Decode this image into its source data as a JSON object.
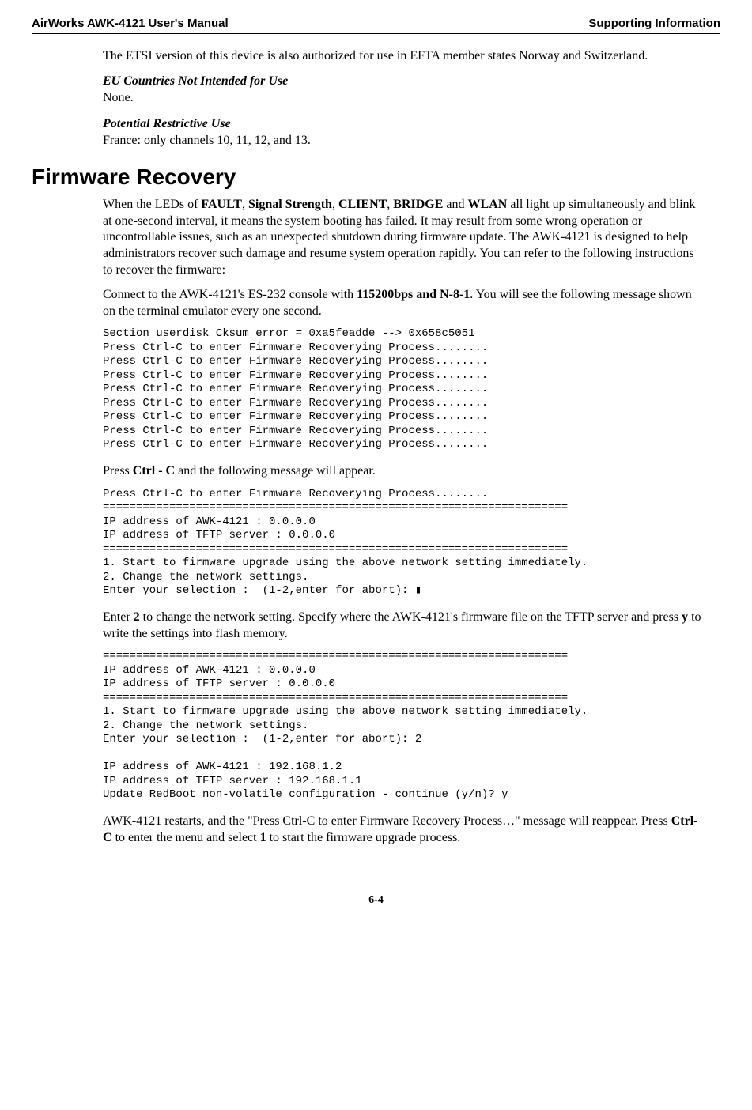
{
  "header": {
    "left": "AirWorks AWK-4121 User's Manual",
    "right": "Supporting Information"
  },
  "intro": {
    "etsi_para": "The ETSI version of this device is also authorized for use in EFTA member states Norway and Switzerland.",
    "eu_head": "EU Countries Not Intended for Use",
    "eu_body": "None.",
    "pr_head": "Potential Restrictive Use",
    "pr_body": "France: only channels 10, 11, 12, and 13."
  },
  "recovery": {
    "title": "Firmware Recovery",
    "p1_pre": "When the LEDs of ",
    "b1": "FAULT",
    "sep": ", ",
    "b2": "Signal Strength",
    "b3": "CLIENT",
    "b4": "BRIDGE",
    "and": " and ",
    "b5": "WLAN",
    "p1_post": " all light up simultaneously and blink at one-second interval, it means the system booting has failed. It may result from some wrong operation or uncontrollable issues, such as an unexpected shutdown during firmware update. The AWK-4121 is designed to help administrators recover such damage and resume system operation rapidly. You can refer to the following instructions to recover the firmware:",
    "p2_pre": "Connect to the AWK-4121's ES-232 console with ",
    "p2_bold": "115200bps and N-8-1",
    "p2_post": ". You will see the following message shown on the terminal emulator every one second.",
    "term1": "Section userdisk Cksum error = 0xa5feadde --> 0x658c5051\nPress Ctrl-C to enter Firmware Recoverying Process........\nPress Ctrl-C to enter Firmware Recoverying Process........\nPress Ctrl-C to enter Firmware Recoverying Process........\nPress Ctrl-C to enter Firmware Recoverying Process........\nPress Ctrl-C to enter Firmware Recoverying Process........\nPress Ctrl-C to enter Firmware Recoverying Process........\nPress Ctrl-C to enter Firmware Recoverying Process........\nPress Ctrl-C to enter Firmware Recoverying Process........",
    "p3_pre": "Press ",
    "p3_bold": "Ctrl - C",
    "p3_post": " and the following message will appear.",
    "term2": "Press Ctrl-C to enter Firmware Recoverying Process........\n======================================================================\nIP address of AWK-4121 : 0.0.0.0\nIP address of TFTP server : 0.0.0.0\n======================================================================\n1. Start to firmware upgrade using the above network setting immediately.\n2. Change the network settings.\nEnter your selection :  (1-2,enter for abort): ▮",
    "p4_pre": "Enter ",
    "p4_b1": "2",
    "p4_mid": " to change the network setting. Specify where the AWK-4121's firmware file on the TFTP server and press ",
    "p4_b2": "y",
    "p4_post": " to write the settings into flash memory.",
    "term3": "======================================================================\nIP address of AWK-4121 : 0.0.0.0\nIP address of TFTP server : 0.0.0.0\n======================================================================\n1. Start to firmware upgrade using the above network setting immediately.\n2. Change the network settings.\nEnter your selection :  (1-2,enter for abort): 2\n\nIP address of AWK-4121 : 192.168.1.2\nIP address of TFTP server : 192.168.1.1\nUpdate RedBoot non-volatile configuration - continue (y/n)? y",
    "p5_pre": "AWK-4121 restarts, and the \"Press Ctrl-C to enter Firmware Recovery Process…\" message will reappear. Press ",
    "p5_b1": "Ctrl-C",
    "p5_mid": " to enter the menu and select ",
    "p5_b2": "1",
    "p5_post": " to start the firmware upgrade process."
  },
  "page_num": "6-4"
}
